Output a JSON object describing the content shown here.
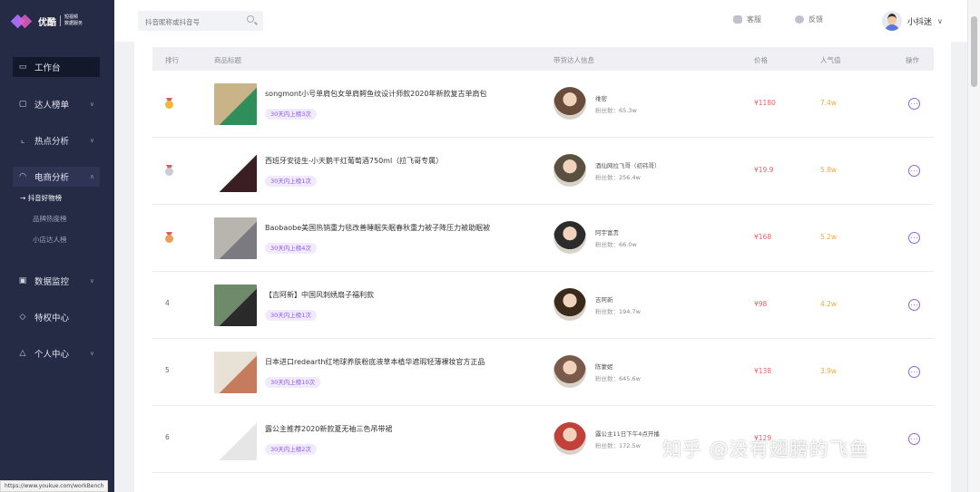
{
  "brand": {
    "name": "优酷",
    "subtitle_line1": "短视频",
    "subtitle_line2": "数据服务"
  },
  "sidebar": {
    "items": [
      {
        "label": "工作台",
        "icon": "monitor-icon"
      },
      {
        "label": "达人榜单",
        "icon": "briefcase-icon"
      },
      {
        "label": "热点分析",
        "icon": "chart-icon"
      },
      {
        "label": "电商分析",
        "icon": "bag-icon"
      },
      {
        "label": "数据监控",
        "icon": "display-icon"
      },
      {
        "label": "特权中心",
        "icon": "diamond-icon"
      },
      {
        "label": "个人中心",
        "icon": "user-icon"
      }
    ],
    "subitems": [
      "抖音好物榜",
      "品牌热度榜",
      "小店达人榜"
    ]
  },
  "topbar": {
    "search_placeholder": "抖音昵称或抖音号",
    "service_label": "客服",
    "feedback_label": "反馈",
    "user_name": "小抖迷"
  },
  "table": {
    "columns": [
      "排行",
      "商品标题",
      "带货达人信息",
      "价格",
      "人气值",
      "操作"
    ],
    "fans_label": "粉丝数：",
    "rows": [
      {
        "rank": "1",
        "medal": "gold",
        "title": "songmont小号单肩包女单肩鳄鱼纹设计师款2020年新款复古单肩包",
        "tag": "30天内上榜3次",
        "kol": "维密",
        "fans": "65.3w",
        "price": "¥1180",
        "popularity": "7.4w",
        "thumb": "#c9b48a",
        "thumb2": "#2f8f5a",
        "avatar": "#6a4c3c"
      },
      {
        "rank": "2",
        "medal": "silver",
        "title": "西班牙安徒生-小天鹅干红葡萄酒750ml（拉飞哥专属）",
        "tag": "30天内上榜1次",
        "kol": "酒仙网拉飞哥（初祎哥）",
        "fans": "256.4w",
        "price": "¥19.9",
        "popularity": "5.8w",
        "thumb": "#ffffff",
        "thumb2": "#3a1e24",
        "avatar": "#5a5040"
      },
      {
        "rank": "3",
        "medal": "bronze",
        "title": "Baobaobe美国热销重力毯改善睡眠失眠春秋重力被子降压力被助眠被",
        "tag": "30天内上榜4次",
        "kol": "阿宇富贵",
        "fans": "66.0w",
        "price": "¥168",
        "popularity": "5.2w",
        "thumb": "#b8b4ae",
        "thumb2": "#7a7a80",
        "avatar": "#2c2c2c"
      },
      {
        "rank": "4",
        "medal": "",
        "title": "【吉阿新】中国风刺绣扇子福利款",
        "tag": "30天内上榜1次",
        "kol": "吉阿新",
        "fans": "194.7w",
        "price": "¥98",
        "popularity": "4.2w",
        "thumb": "#6f8a6a",
        "thumb2": "#2a2a2a",
        "avatar": "#3a2a1a"
      },
      {
        "rank": "5",
        "medal": "",
        "title": "日本进口redearth红地球养肤粉底液草本植华遮瑕轻薄裸妆官方正品",
        "tag": "30天内上榜10次",
        "kol": "陈蒙妮",
        "fans": "645.6w",
        "price": "¥138",
        "popularity": "3.9w",
        "thumb": "#e8e2d6",
        "thumb2": "#c67b5c",
        "avatar": "#7a5a4a"
      },
      {
        "rank": "6",
        "medal": "",
        "title": "露公主推荐2020新款夏无袖三色吊带裙",
        "tag": "30天内上榜2次",
        "kol": "露公主11日下午4点开播",
        "fans": "172.5w",
        "price": "¥129",
        "popularity": "",
        "thumb": "#ffffff",
        "thumb2": "#e6e6e6",
        "avatar": "#c2403a"
      }
    ]
  },
  "statusbar": {
    "url": "https://www.youkue.com/workBench"
  },
  "watermark": "知乎 @没有翅膀的飞鱼"
}
